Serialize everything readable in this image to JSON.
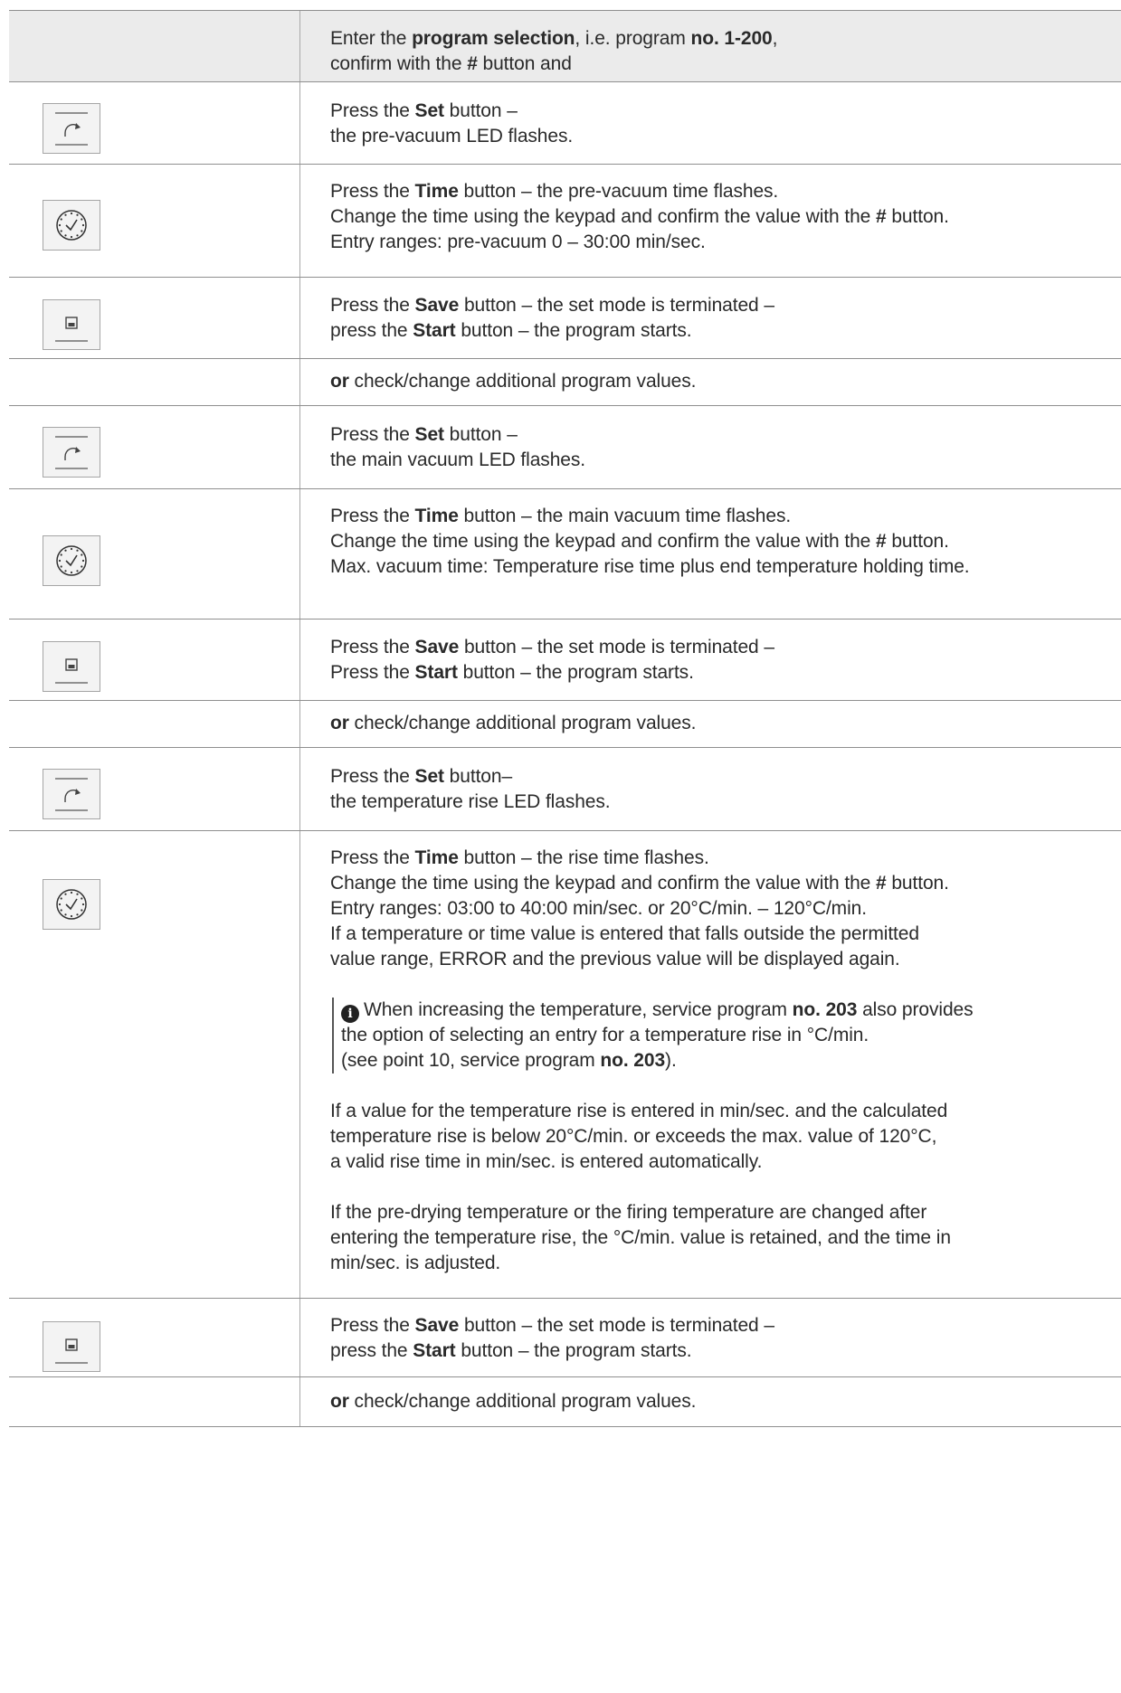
{
  "rows": [
    {
      "icon": "",
      "lines": [
        [
          {
            "t": "Enter the "
          },
          {
            "t": "program selection",
            "b": true
          },
          {
            "t": ", i.e. program "
          },
          {
            "t": "no. 1-200",
            "b": true
          },
          {
            "t": ","
          }
        ],
        [
          {
            "t": "confirm with the "
          },
          {
            "t": "#",
            "b": true
          },
          {
            "t": " button and"
          }
        ]
      ]
    },
    {
      "icon": "set-icon",
      "lines": [
        [
          {
            "t": "Press the "
          },
          {
            "t": "Set",
            "b": true
          },
          {
            "t": " button –"
          }
        ],
        [
          {
            "t": "the pre-vacuum LED flashes."
          }
        ]
      ]
    },
    {
      "icon": "clock-icon",
      "lines": [
        [
          {
            "t": "Press the "
          },
          {
            "t": "Time",
            "b": true
          },
          {
            "t": " button – the pre-vacuum time flashes."
          }
        ],
        [
          {
            "t": "Change the time using the keypad and confirm the value with the "
          },
          {
            "t": "#",
            "b": true
          },
          {
            "t": " button."
          }
        ],
        [
          {
            "t": "Entry ranges: pre-vacuum 0 – 30:00 min/sec."
          }
        ]
      ]
    },
    {
      "icon": "save-icon",
      "lines": [
        [
          {
            "t": "Press the "
          },
          {
            "t": "Save",
            "b": true
          },
          {
            "t": " button – the set mode is terminated –"
          }
        ],
        [
          {
            "t": "press the "
          },
          {
            "t": "Start",
            "b": true
          },
          {
            "t": " button – the program starts."
          }
        ]
      ]
    },
    {
      "icon": "",
      "lines": [
        [
          {
            "t": "or",
            "b": true
          },
          {
            "t": " check/change additional program values."
          }
        ]
      ]
    },
    {
      "icon": "set-icon",
      "lines": [
        [
          {
            "t": "Press the "
          },
          {
            "t": "Set",
            "b": true
          },
          {
            "t": " button –"
          }
        ],
        [
          {
            "t": "the main vacuum LED flashes."
          }
        ]
      ]
    },
    {
      "icon": "clock-icon",
      "lines": [
        [
          {
            "t": "Press the "
          },
          {
            "t": "Time",
            "b": true
          },
          {
            "t": " button – the main vacuum time flashes."
          }
        ],
        [
          {
            "t": "Change the time using the keypad and confirm the value with the "
          },
          {
            "t": "#",
            "b": true
          },
          {
            "t": " button."
          }
        ],
        [
          {
            "t": "Max. vacuum time: Temperature rise time plus end temperature holding time."
          }
        ]
      ]
    },
    {
      "icon": "save-icon",
      "lines": [
        [
          {
            "t": "Press the "
          },
          {
            "t": "Save",
            "b": true
          },
          {
            "t": " button – the set mode is terminated –"
          }
        ],
        [
          {
            "t": "Press the "
          },
          {
            "t": "Start",
            "b": true
          },
          {
            "t": " button – the program starts."
          }
        ]
      ]
    },
    {
      "icon": "",
      "lines": [
        [
          {
            "t": "or",
            "b": true
          },
          {
            "t": " check/change additional program values."
          }
        ]
      ]
    },
    {
      "icon": "set-icon",
      "lines": [
        [
          {
            "t": "Press the "
          },
          {
            "t": "Set",
            "b": true
          },
          {
            "t": " button–"
          }
        ],
        [
          {
            "t": "the temperature rise LED flashes."
          }
        ]
      ]
    },
    {
      "icon": "clock-icon",
      "lines": [
        [
          {
            "t": "Press the "
          },
          {
            "t": "Time",
            "b": true
          },
          {
            "t": " button – the rise time flashes."
          }
        ],
        [
          {
            "t": "Change the time using the keypad and confirm the value with the "
          },
          {
            "t": "#",
            "b": true
          },
          {
            "t": " button."
          }
        ],
        [
          {
            "t": "Entry ranges: 03:00 to 40:00 min/sec. or 20°C/min. – 120°C/min."
          }
        ],
        [
          {
            "t": "If a temperature or time value is entered that falls outside the permitted"
          }
        ],
        [
          {
            "t": "value range, ERROR and the previous value will be displayed again."
          }
        ],
        "gap",
        {
          "note": [
            [
              {
                "t": "When increasing the temperature, service program "
              },
              {
                "t": "no. 203",
                "b": true
              },
              {
                "t": " also provides"
              }
            ],
            [
              {
                "t": "the option of selecting an entry for a temperature rise in °C/min."
              }
            ],
            [
              {
                "t": "(see point 10, service program "
              },
              {
                "t": "no. 203",
                "b": true
              },
              {
                "t": ")."
              }
            ]
          ]
        },
        "gap",
        [
          {
            "t": "If a value for the temperature rise is entered in min/sec. and the calculated"
          }
        ],
        [
          {
            "t": "temperature rise is below 20°C/min. or exceeds the max. value of 120°C,"
          }
        ],
        [
          {
            "t": "a valid rise time in min/sec. is entered automatically."
          }
        ],
        "gap",
        [
          {
            "t": "If the pre-drying temperature or the firing temperature are changed after"
          }
        ],
        [
          {
            "t": "entering the temperature rise, the °C/min. value is retained, and the time in"
          }
        ],
        [
          {
            "t": "min/sec. is adjusted."
          }
        ]
      ]
    },
    {
      "icon": "save-icon",
      "lines": [
        [
          {
            "t": "Press the "
          },
          {
            "t": "Save",
            "b": true
          },
          {
            "t": " button – the set mode is terminated –"
          }
        ],
        [
          {
            "t": "press the "
          },
          {
            "t": "Start",
            "b": true
          },
          {
            "t": " button – the program starts."
          }
        ]
      ]
    },
    {
      "icon": "",
      "lines": [
        [
          {
            "t": "or",
            "b": true
          },
          {
            "t": " check/change additional program values."
          }
        ]
      ]
    }
  ]
}
